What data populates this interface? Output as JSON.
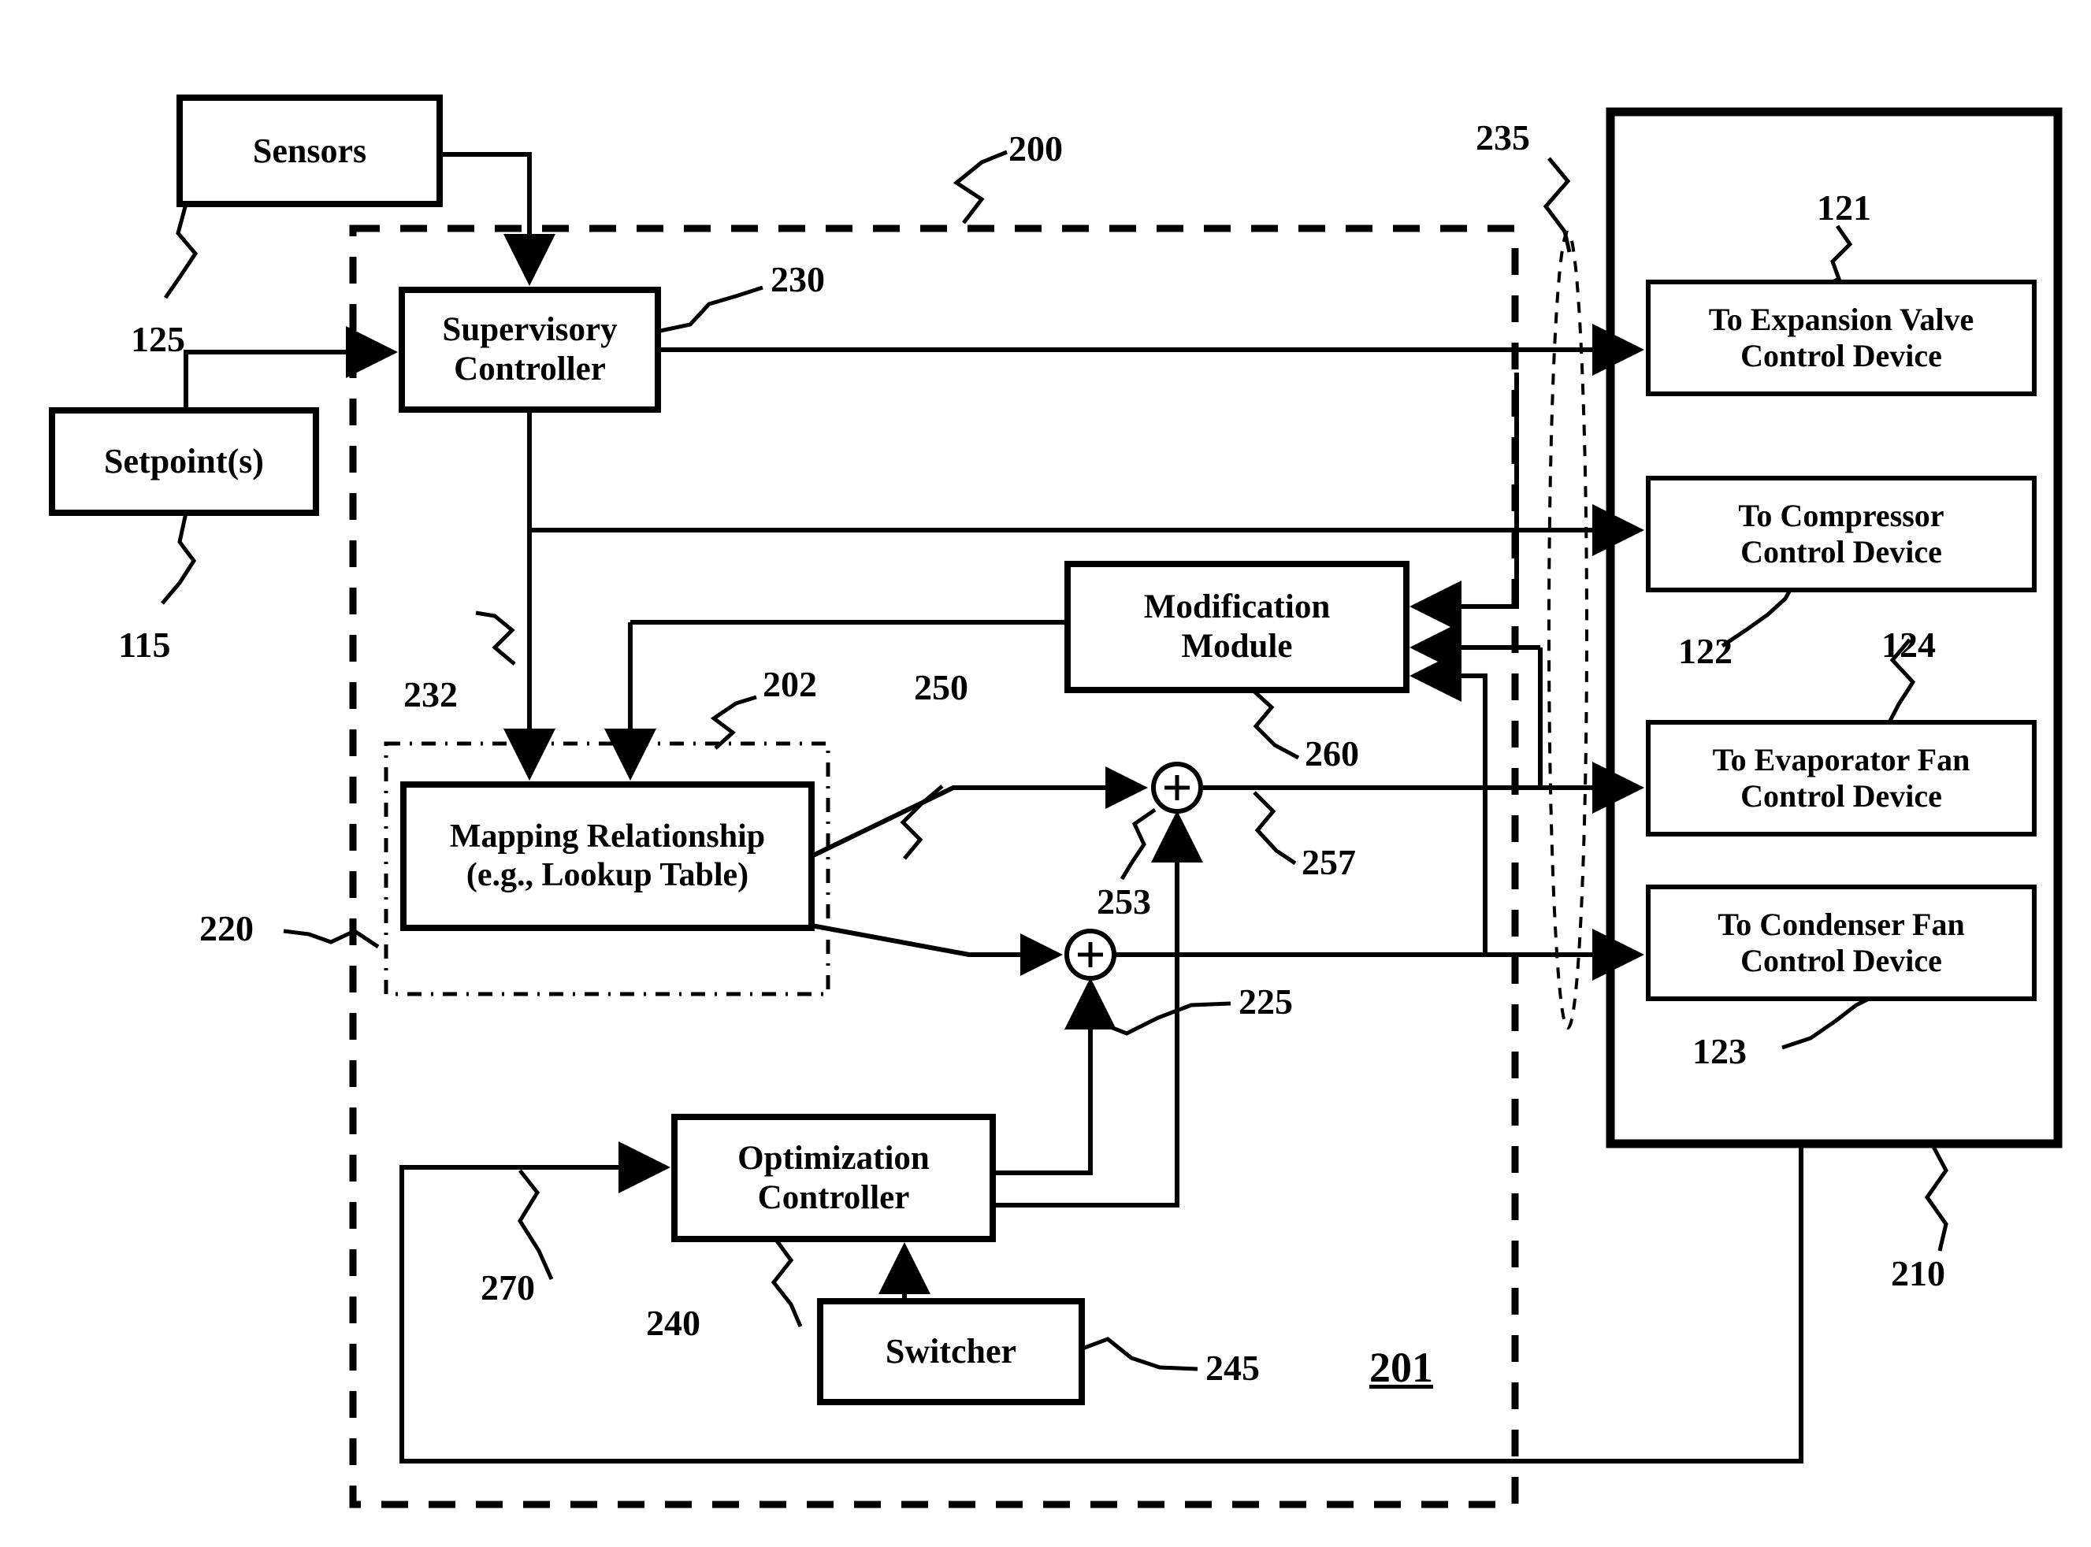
{
  "figure": {
    "title": "Refrigeration control system block diagram",
    "stroke_color": "#000000",
    "background": "#ffffff"
  },
  "blocks": {
    "sensors": {
      "label": "Sensors"
    },
    "setpoints": {
      "label": "Setpoint(s)"
    },
    "supervisory_controller": {
      "line1": "Supervisory",
      "line2": "Controller"
    },
    "mapping_relationship": {
      "line1": "Mapping Relationship",
      "line2": "(e.g., Lookup Table)"
    },
    "modification_module": {
      "line1": "Modification",
      "line2": "Module"
    },
    "optimization_controller": {
      "line1": "Optimization",
      "line2": "Controller"
    },
    "switcher": {
      "label": "Switcher"
    },
    "expansion_valve_device": {
      "line1": "To Expansion Valve",
      "line2": "Control Device"
    },
    "compressor_device": {
      "line1": "To Compressor",
      "line2": "Control Device"
    },
    "evaporator_fan_device": {
      "line1": "To Evaporator Fan",
      "line2": "Control Device"
    },
    "condenser_fan_device": {
      "line1": "To Condenser Fan",
      "line2": "Control Device"
    }
  },
  "reference_numerals": {
    "n115": "115",
    "n121": "121",
    "n122": "122",
    "n123": "123",
    "n124": "124",
    "n125": "125",
    "n200": "200",
    "n201": "201",
    "n202": "202",
    "n210": "210",
    "n220": "220",
    "n225": "225",
    "n230": "230",
    "n232": "232",
    "n235": "235",
    "n240": "240",
    "n245": "245",
    "n250": "250",
    "n253": "253",
    "n257": "257",
    "n260": "260",
    "n270": "270"
  },
  "symbols": {
    "summing_junction_upper": "+",
    "summing_junction_lower": "+"
  }
}
